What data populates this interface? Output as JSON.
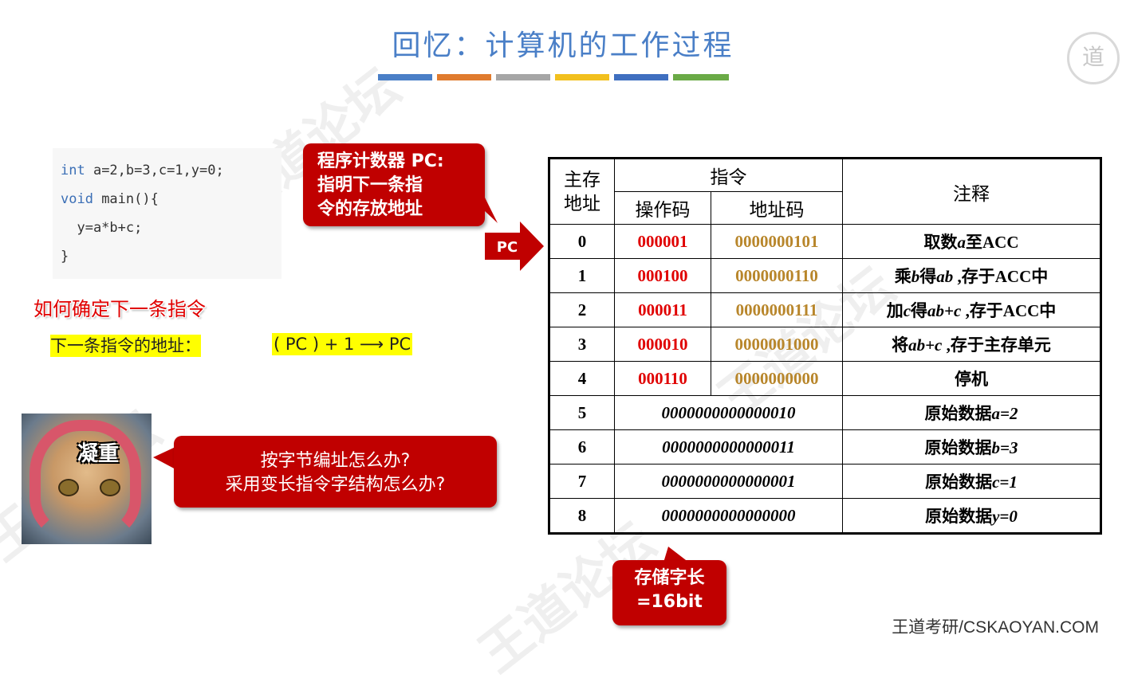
{
  "title": "回忆：计算机的工作过程",
  "title_bar_colors": [
    "#4a7fc7",
    "#e07b2e",
    "#a6a6a6",
    "#f2c01e",
    "#3f6fc0",
    "#6aaa46"
  ],
  "code": {
    "line1_kw": "int",
    "line1_rest": " a=2,b=3,c=1,y=0;",
    "line2_kw": "void",
    "line2_rest": " main(){",
    "line3": "  y=a*b+c;",
    "line4": "}"
  },
  "pc_callout": {
    "line1": "程序计数器 PC:",
    "line2": "指明下一条指",
    "line3": "令的存放地址"
  },
  "pc_arrow_label": "PC",
  "question_heading": "如何确定下一条指令",
  "next_addr_label": "下一条指令的地址：",
  "next_addr_formula": "( PC ) + 1 ⟶ PC",
  "cat_label": "凝重",
  "question_callout": {
    "line1": "按字节编址怎么办?",
    "line2": "采用变长指令字结构怎么办?"
  },
  "word_callout": {
    "line1": "存储字长",
    "line2": "=16bit"
  },
  "table": {
    "header_addr_1": "主存",
    "header_addr_2": "地址",
    "header_instr": "指令",
    "header_opcode": "操作码",
    "header_addrcode": "地址码",
    "header_note": "注释",
    "instr_rows": [
      {
        "addr": "0",
        "op": "000001",
        "ad": "0000000101",
        "note_a": "取数",
        "note_v": "a",
        "note_b": "至ACC"
      },
      {
        "addr": "1",
        "op": "000100",
        "ad": "0000000110",
        "note_a": "乘",
        "note_v": "b",
        "note_b": "得",
        "note_v2": "ab",
        "note_c": " ,存于ACC中"
      },
      {
        "addr": "2",
        "op": "000011",
        "ad": "0000000111",
        "note_a": "加",
        "note_v": "c",
        "note_b": "得",
        "note_v2": "ab+c",
        "note_c": "  ,存于ACC中"
      },
      {
        "addr": "3",
        "op": "000010",
        "ad": "0000001000",
        "note_a": "将",
        "note_v": "ab+c",
        "note_b": " ,存于主存单元"
      },
      {
        "addr": "4",
        "op": "000110",
        "ad": "0000000000",
        "note_a": "停机"
      }
    ],
    "data_rows": [
      {
        "addr": "5",
        "data": "0000000000000010",
        "note_a": "原始数据",
        "note_v": "a=2"
      },
      {
        "addr": "6",
        "data": "0000000000000011",
        "note_a": "原始数据",
        "note_v": "b=3"
      },
      {
        "addr": "7",
        "data": "0000000000000001",
        "note_a": "原始数据",
        "note_v": "c=1"
      },
      {
        "addr": "8",
        "data": "0000000000000000",
        "note_a": "原始数据",
        "note_v": "y=0"
      }
    ]
  },
  "footer": "王道考研/CSKAOYAN.COM"
}
